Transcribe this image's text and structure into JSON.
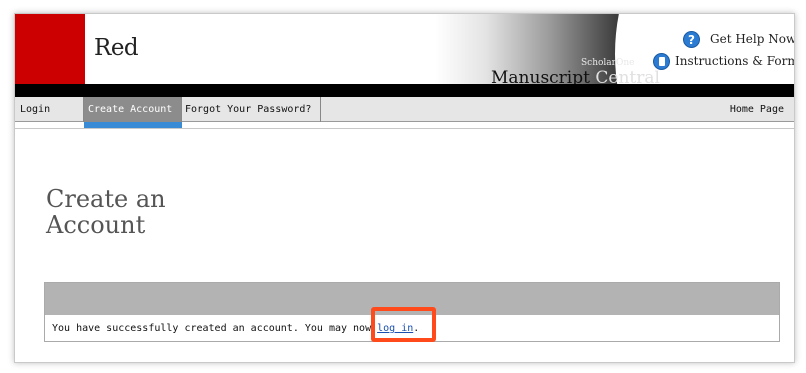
{
  "header": {
    "brand": "Red",
    "product_small": "ScholarOne",
    "product_word1": "Manuscript",
    "product_word2": "Central",
    "help_label": "Get Help Now",
    "forms_label": "Instructions & Forms",
    "colors": {
      "brand_red": "#cc0000",
      "icon_blue": "#2a7bd1"
    }
  },
  "nav": {
    "login": "Login",
    "create_account": "Create Account",
    "forgot_password": "Forgot Your Password?",
    "home_page": "Home Page",
    "active_tab": "Create Account"
  },
  "page": {
    "title": "Create an Account",
    "message_prefix": "You have successfully created an account. You may now ",
    "login_link": "log in",
    "message_suffix": "."
  },
  "icons": {
    "help": "question-mark-icon",
    "forms": "document-icon"
  }
}
